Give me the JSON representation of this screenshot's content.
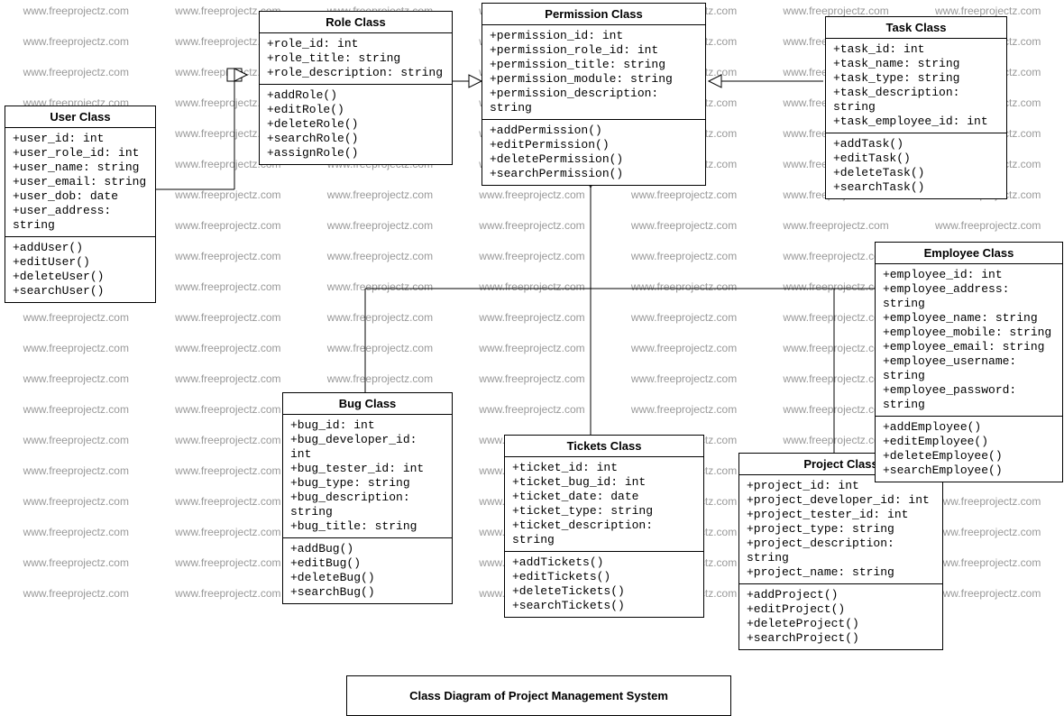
{
  "watermark": "www.freeprojectz.com",
  "title": "Class Diagram of Project Management System",
  "classes": {
    "user": {
      "name": "User Class",
      "attrs": [
        "+user_id: int",
        "+user_role_id: int",
        "+user_name: string",
        "+user_email: string",
        "+user_dob: date",
        "+user_address: string"
      ],
      "ops": [
        "+addUser()",
        "+editUser()",
        "+deleteUser()",
        "+searchUser()"
      ]
    },
    "role": {
      "name": "Role Class",
      "attrs": [
        "+role_id: int",
        "+role_title: string",
        "+role_description: string"
      ],
      "ops": [
        "+addRole()",
        "+editRole()",
        "+deleteRole()",
        "+searchRole()",
        "+assignRole()"
      ]
    },
    "permission": {
      "name": "Permission Class",
      "attrs": [
        "+permission_id: int",
        "+permission_role_id: int",
        "+permission_title: string",
        "+permission_module: string",
        "+permission_description: string"
      ],
      "ops": [
        "+addPermission()",
        "+editPermission()",
        "+deletePermission()",
        "+searchPermission()"
      ]
    },
    "task": {
      "name": "Task Class",
      "attrs": [
        "+task_id: int",
        "+task_name: string",
        "+task_type: string",
        "+task_description: string",
        "+task_employee_id: int"
      ],
      "ops": [
        "+addTask()",
        "+editTask()",
        "+deleteTask()",
        "+searchTask()"
      ]
    },
    "bug": {
      "name": "Bug Class",
      "attrs": [
        "+bug_id: int",
        "+bug_developer_id: int",
        "+bug_tester_id: int",
        "+bug_type: string",
        "+bug_description: string",
        "+bug_title: string"
      ],
      "ops": [
        "+addBug()",
        "+editBug()",
        "+deleteBug()",
        "+searchBug()"
      ]
    },
    "tickets": {
      "name": "Tickets Class",
      "attrs": [
        "+ticket_id: int",
        "+ticket_bug_id: int",
        "+ticket_date: date",
        "+ticket_type: string",
        "+ticket_description: string"
      ],
      "ops": [
        "+addTickets()",
        "+editTickets()",
        "+deleteTickets()",
        "+searchTickets()"
      ]
    },
    "project": {
      "name": "Project Class",
      "attrs": [
        "+project_id: int",
        "+project_developer_id: int",
        "+project_tester_id: int",
        "+project_type: string",
        "+project_description: string",
        "+project_name: string"
      ],
      "ops": [
        "+addProject()",
        "+editProject()",
        "+deleteProject()",
        "+searchProject()"
      ]
    },
    "employee": {
      "name": "Employee Class",
      "attrs": [
        "+employee_id: int",
        "+employee_address: string",
        "+employee_name: string",
        "+employee_mobile: string",
        "+employee_email: string",
        "+employee_username: string",
        "+employee_password: string"
      ],
      "ops": [
        "+addEmployee()",
        "+editEmployee()",
        "+deleteEmployee()",
        "+searchEmployee()"
      ]
    }
  }
}
